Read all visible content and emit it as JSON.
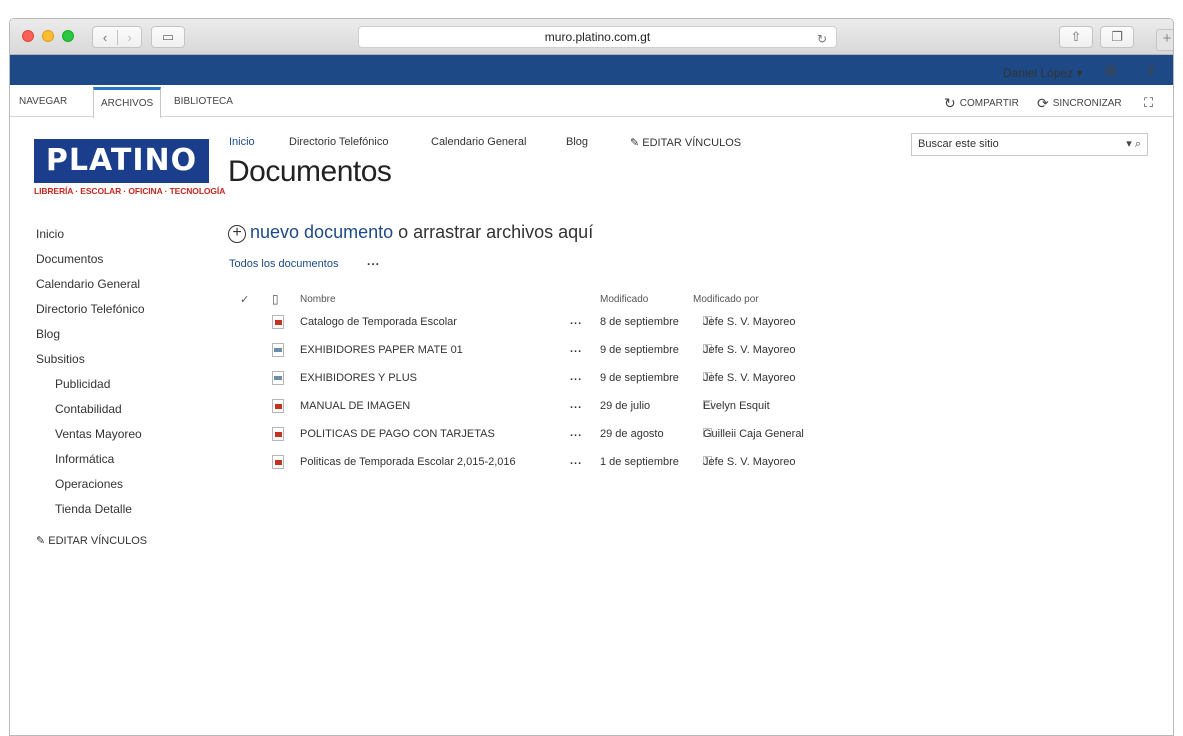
{
  "browser": {
    "url": "muro.platino.com.gt"
  },
  "suite": {
    "user": "Daniel López ▾",
    "help": "?"
  },
  "ribbon": {
    "tabs": [
      "NAVEGAR",
      "ARCHIVOS",
      "BIBLIOTECA"
    ],
    "active_tab": "ARCHIVOS",
    "share": "COMPARTIR",
    "sync": "SINCRONIZAR"
  },
  "logo": {
    "name": "PLATINO",
    "tagline": "LIBRERÍA · ESCOLAR · OFICINA · TECNOLOGÍA"
  },
  "leftnav": {
    "items": [
      "Inicio",
      "Documentos",
      "Calendario General",
      "Directorio Telefónico",
      "Blog",
      "Subsitios"
    ],
    "subitems": [
      "Publicidad",
      "Contabilidad",
      "Ventas Mayoreo",
      "Informática",
      "Operaciones",
      "Tienda Detalle"
    ],
    "edit": "EDITAR VÍNCULOS"
  },
  "topnav": {
    "items": [
      "Inicio",
      "Directorio Telefónico",
      "Calendario General",
      "Blog"
    ],
    "edit": "EDITAR VÍNCULOS"
  },
  "page": {
    "title": "Documentos"
  },
  "search": {
    "placeholder": "Buscar este sitio"
  },
  "library": {
    "new_link": "nuevo documento",
    "new_rest": " o arrastrar archivos aquí",
    "view": "Todos los documentos",
    "view_more": "...",
    "columns": {
      "name": "Nombre",
      "modified": "Modificado",
      "modified_by": "Modificado por"
    },
    "rows": [
      {
        "name": "Catalogo de Temporada Escolar",
        "icon": "pdf-icon",
        "modified": "8 de septiembre",
        "by": "Jefe S. V. Mayoreo"
      },
      {
        "name": "EXHIBIDORES PAPER MATE 01",
        "icon": "image-icon",
        "modified": "9 de septiembre",
        "by": "Jefe S. V. Mayoreo"
      },
      {
        "name": "EXHIBIDORES Y PLUS",
        "icon": "image-icon",
        "modified": "9 de septiembre",
        "by": "Jefe S. V. Mayoreo"
      },
      {
        "name": "MANUAL DE IMAGEN",
        "icon": "pdf-icon",
        "modified": "29 de julio",
        "by": "Evelyn Esquit"
      },
      {
        "name": "POLITICAS DE PAGO CON TARJETAS",
        "icon": "pdf-icon",
        "modified": "29 de agosto",
        "by": "Guilleii Caja General"
      },
      {
        "name": "Politicas de Temporada Escolar 2,015-2,016",
        "icon": "pdf-icon",
        "modified": "1 de septiembre",
        "by": "Jefe S. V. Mayoreo"
      }
    ],
    "row_menu": "..."
  },
  "colors": {
    "suite_bar": "#1d4a86",
    "link": "#1d4a86",
    "logo_bg": "#1b3e8c",
    "logo_tagline": "#c4271d"
  }
}
